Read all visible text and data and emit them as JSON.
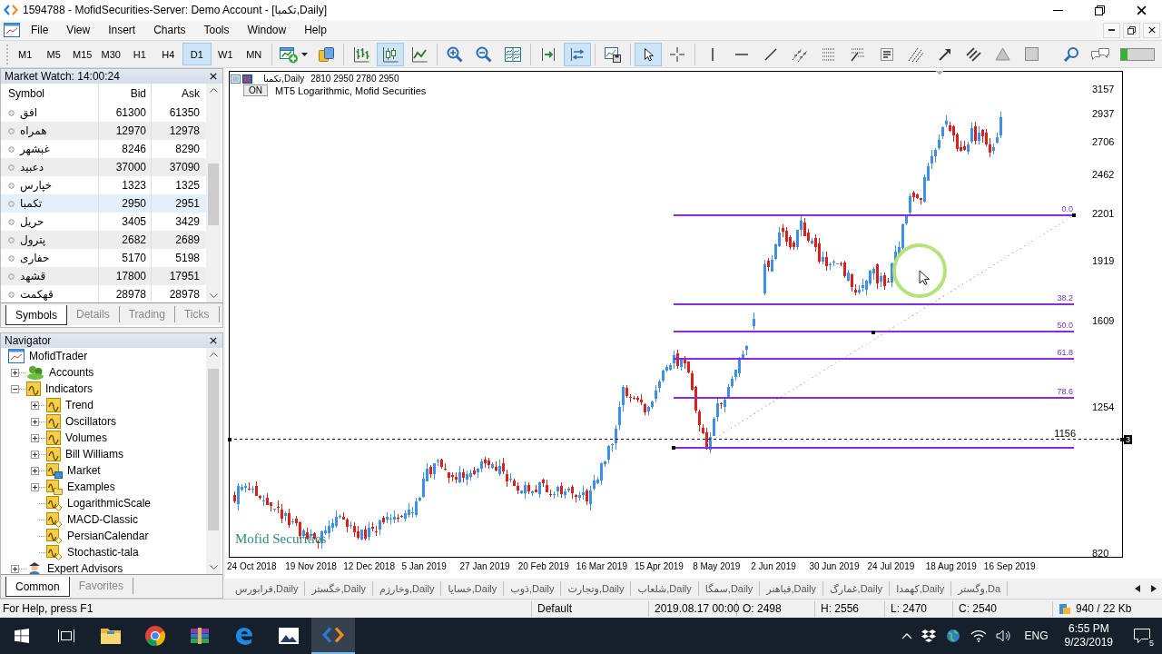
{
  "window": {
    "title": "1594788 - MofidSecurities-Server: Demo Account - [تکمبا,Daily]"
  },
  "menu": [
    "File",
    "View",
    "Insert",
    "Charts",
    "Tools",
    "Window",
    "Help"
  ],
  "toolbar": {
    "timeframes": [
      {
        "label": "M1",
        "selected": false
      },
      {
        "label": "M5",
        "selected": false
      },
      {
        "label": "M15",
        "selected": false
      },
      {
        "label": "M30",
        "selected": false
      },
      {
        "label": "H1",
        "selected": false
      },
      {
        "label": "H4",
        "selected": false
      },
      {
        "label": "D1",
        "selected": true
      },
      {
        "label": "W1",
        "selected": false
      },
      {
        "label": "MN",
        "selected": false
      }
    ],
    "tools": [
      {
        "kind": "new-chart",
        "selected": false
      },
      {
        "kind": "profiles",
        "selected": false
      },
      {
        "kind": "bar-chart",
        "selected": false
      },
      {
        "kind": "candlesticks",
        "selected": true
      },
      {
        "kind": "line-chart",
        "selected": false
      },
      {
        "kind": "zoom-in",
        "selected": false
      },
      {
        "kind": "zoom-out",
        "selected": false
      },
      {
        "kind": "tile-windows",
        "selected": false
      },
      {
        "kind": "auto-scroll",
        "selected": false
      },
      {
        "kind": "chart-shift",
        "selected": true
      },
      {
        "kind": "templates",
        "selected": false
      },
      {
        "kind": "cursor",
        "selected": true
      },
      {
        "kind": "crosshair",
        "selected": false
      },
      {
        "kind": "vertical-line",
        "selected": false
      },
      {
        "kind": "horizontal-line",
        "selected": false
      },
      {
        "kind": "trendline",
        "selected": false
      },
      {
        "kind": "equidistant-channel",
        "selected": false
      },
      {
        "kind": "fibonacci-retracement",
        "selected": false
      },
      {
        "kind": "fibonacci-expansion",
        "selected": false
      },
      {
        "kind": "text-label",
        "selected": false
      },
      {
        "kind": "andrews-pitchfork",
        "selected": false
      },
      {
        "kind": "arrow",
        "selected": false
      },
      {
        "kind": "parallel-lines",
        "selected": false
      },
      {
        "kind": "triangle",
        "selected": false
      },
      {
        "kind": "rectangle",
        "selected": false
      },
      {
        "kind": "search",
        "selected": false
      },
      {
        "kind": "chat",
        "selected": false
      }
    ]
  },
  "market_watch": {
    "title": "Market Watch: 14:00:24",
    "columns": [
      "Symbol",
      "Bid",
      "Ask"
    ],
    "rows": [
      {
        "symbol": "افق",
        "bid": "61300",
        "ask": "61350",
        "selected": false
      },
      {
        "symbol": "همراه",
        "bid": "12970",
        "ask": "12978",
        "selected": false
      },
      {
        "symbol": "غبشهر",
        "bid": "8246",
        "ask": "8290",
        "selected": false
      },
      {
        "symbol": "دعبید",
        "bid": "37000",
        "ask": "37090",
        "selected": false
      },
      {
        "symbol": "خپارس",
        "bid": "1323",
        "ask": "1325",
        "selected": false
      },
      {
        "symbol": "تکمبا",
        "bid": "2950",
        "ask": "2951",
        "selected": true
      },
      {
        "symbol": "حریل",
        "bid": "3405",
        "ask": "3429",
        "selected": false
      },
      {
        "symbol": "پترول",
        "bid": "2682",
        "ask": "2689",
        "selected": false
      },
      {
        "symbol": "حفاری",
        "bid": "5170",
        "ask": "5198",
        "selected": false
      },
      {
        "symbol": "قشهد",
        "bid": "17800",
        "ask": "17951",
        "selected": false
      },
      {
        "symbol": "قهکمت",
        "bid": "28978",
        "ask": "28978",
        "selected": false
      }
    ],
    "tabs": [
      {
        "label": "Symbols",
        "selected": true
      },
      {
        "label": "Details",
        "selected": false
      },
      {
        "label": "Trading",
        "selected": false
      },
      {
        "label": "Ticks",
        "selected": false
      }
    ]
  },
  "navigator": {
    "title": "Navigator",
    "tree": [
      {
        "label": "MofidTrader",
        "kind": "root",
        "children": [
          {
            "label": "Accounts",
            "kind": "accounts",
            "expanded": false
          },
          {
            "label": "Indicators",
            "kind": "folder",
            "expanded": true,
            "children": [
              {
                "label": "Trend",
                "kind": "folder",
                "expanded": false
              },
              {
                "label": "Oscillators",
                "kind": "folder",
                "expanded": false
              },
              {
                "label": "Volumes",
                "kind": "folder",
                "expanded": false
              },
              {
                "label": "Bill Williams",
                "kind": "folder",
                "expanded": false
              },
              {
                "label": "Market",
                "kind": "market",
                "expanded": false
              },
              {
                "label": "Examples",
                "kind": "examples",
                "expanded": false
              },
              {
                "label": "LogarithmicScale",
                "kind": "custom"
              },
              {
                "label": "MACD-Classic",
                "kind": "custom"
              },
              {
                "label": "PersianCalendar",
                "kind": "custom"
              },
              {
                "label": "Stochastic-tala",
                "kind": "custom"
              }
            ]
          },
          {
            "label": "Expert Advisors",
            "kind": "experts",
            "expanded": false
          }
        ]
      }
    ],
    "tabs": [
      {
        "label": "Common",
        "selected": true
      },
      {
        "label": "Favorites",
        "selected": false
      }
    ]
  },
  "chart": {
    "symbol": "تکمبا,Daily",
    "quote": "2810 2950 2780 2950",
    "indicator_button": "ON",
    "indicator": "MT5 Logarithmic, Mofid Securities",
    "logo": "Mofid Securities",
    "price_labels": [
      "3157",
      "2937",
      "2706",
      "2462",
      "2201",
      "1919",
      "1609",
      "1254",
      "820"
    ],
    "date_labels": [
      "24 Oct 2018",
      "19 Nov 2018",
      "12 Dec 2018",
      "5 Jan 2019",
      "27 Jan 2019",
      "20 Feb 2019",
      "16 Mar 2019",
      "15 Apr 2019",
      "8 May 2019",
      "2 Jun 2019",
      "30 Jun 2019",
      "24 Jul 2019",
      "18 Aug 2019",
      "16 Sep 2019"
    ],
    "fibonacci_levels": [
      "0.0",
      "38.2",
      "50.0",
      "61.8",
      "78.6"
    ],
    "line_label": "1156",
    "line_marker": "3"
  },
  "chart_tabs": [
    {
      "label": "فرابورس,Daily",
      "selected": false
    },
    {
      "label": "خگستر,Daily",
      "selected": false
    },
    {
      "label": "وخارزم,Daily",
      "selected": false
    },
    {
      "label": "خسایا,Daily",
      "selected": false
    },
    {
      "label": "ذوب,Daily",
      "selected": false
    },
    {
      "label": "وتجارت,Daily",
      "selected": false
    },
    {
      "label": "شلعاب,Daily",
      "selected": false
    },
    {
      "label": "سمگا,Daily",
      "selected": false
    },
    {
      "label": "فباهنر,Daily",
      "selected": false
    },
    {
      "label": "غمارگ,Daily",
      "selected": false
    },
    {
      "label": "کهمدا,Daily",
      "selected": false
    },
    {
      "label": "وگستر,Da",
      "selected": false
    }
  ],
  "status_bar": {
    "help": "For Help, press F1",
    "profile": "Default",
    "time": "2019.08.17 00:00",
    "open": "O: 2498",
    "high": "H: 2556",
    "low": "L: 2470",
    "close": "C: 2540",
    "traffic": "940 / 22 Kb"
  },
  "taskbar": {
    "buttons": [
      {
        "kind": "start",
        "selected": false
      },
      {
        "kind": "task-view",
        "selected": false
      },
      {
        "kind": "file-explorer",
        "selected": false
      },
      {
        "kind": "browser",
        "selected": false
      },
      {
        "kind": "archiver",
        "selected": false
      },
      {
        "kind": "web-browser",
        "selected": false
      },
      {
        "kind": "photos",
        "selected": false
      },
      {
        "kind": "editor",
        "selected": true
      }
    ],
    "language": "ENG",
    "time": "6:55 PM",
    "date": "9/23/2019",
    "notifications": "5"
  }
}
